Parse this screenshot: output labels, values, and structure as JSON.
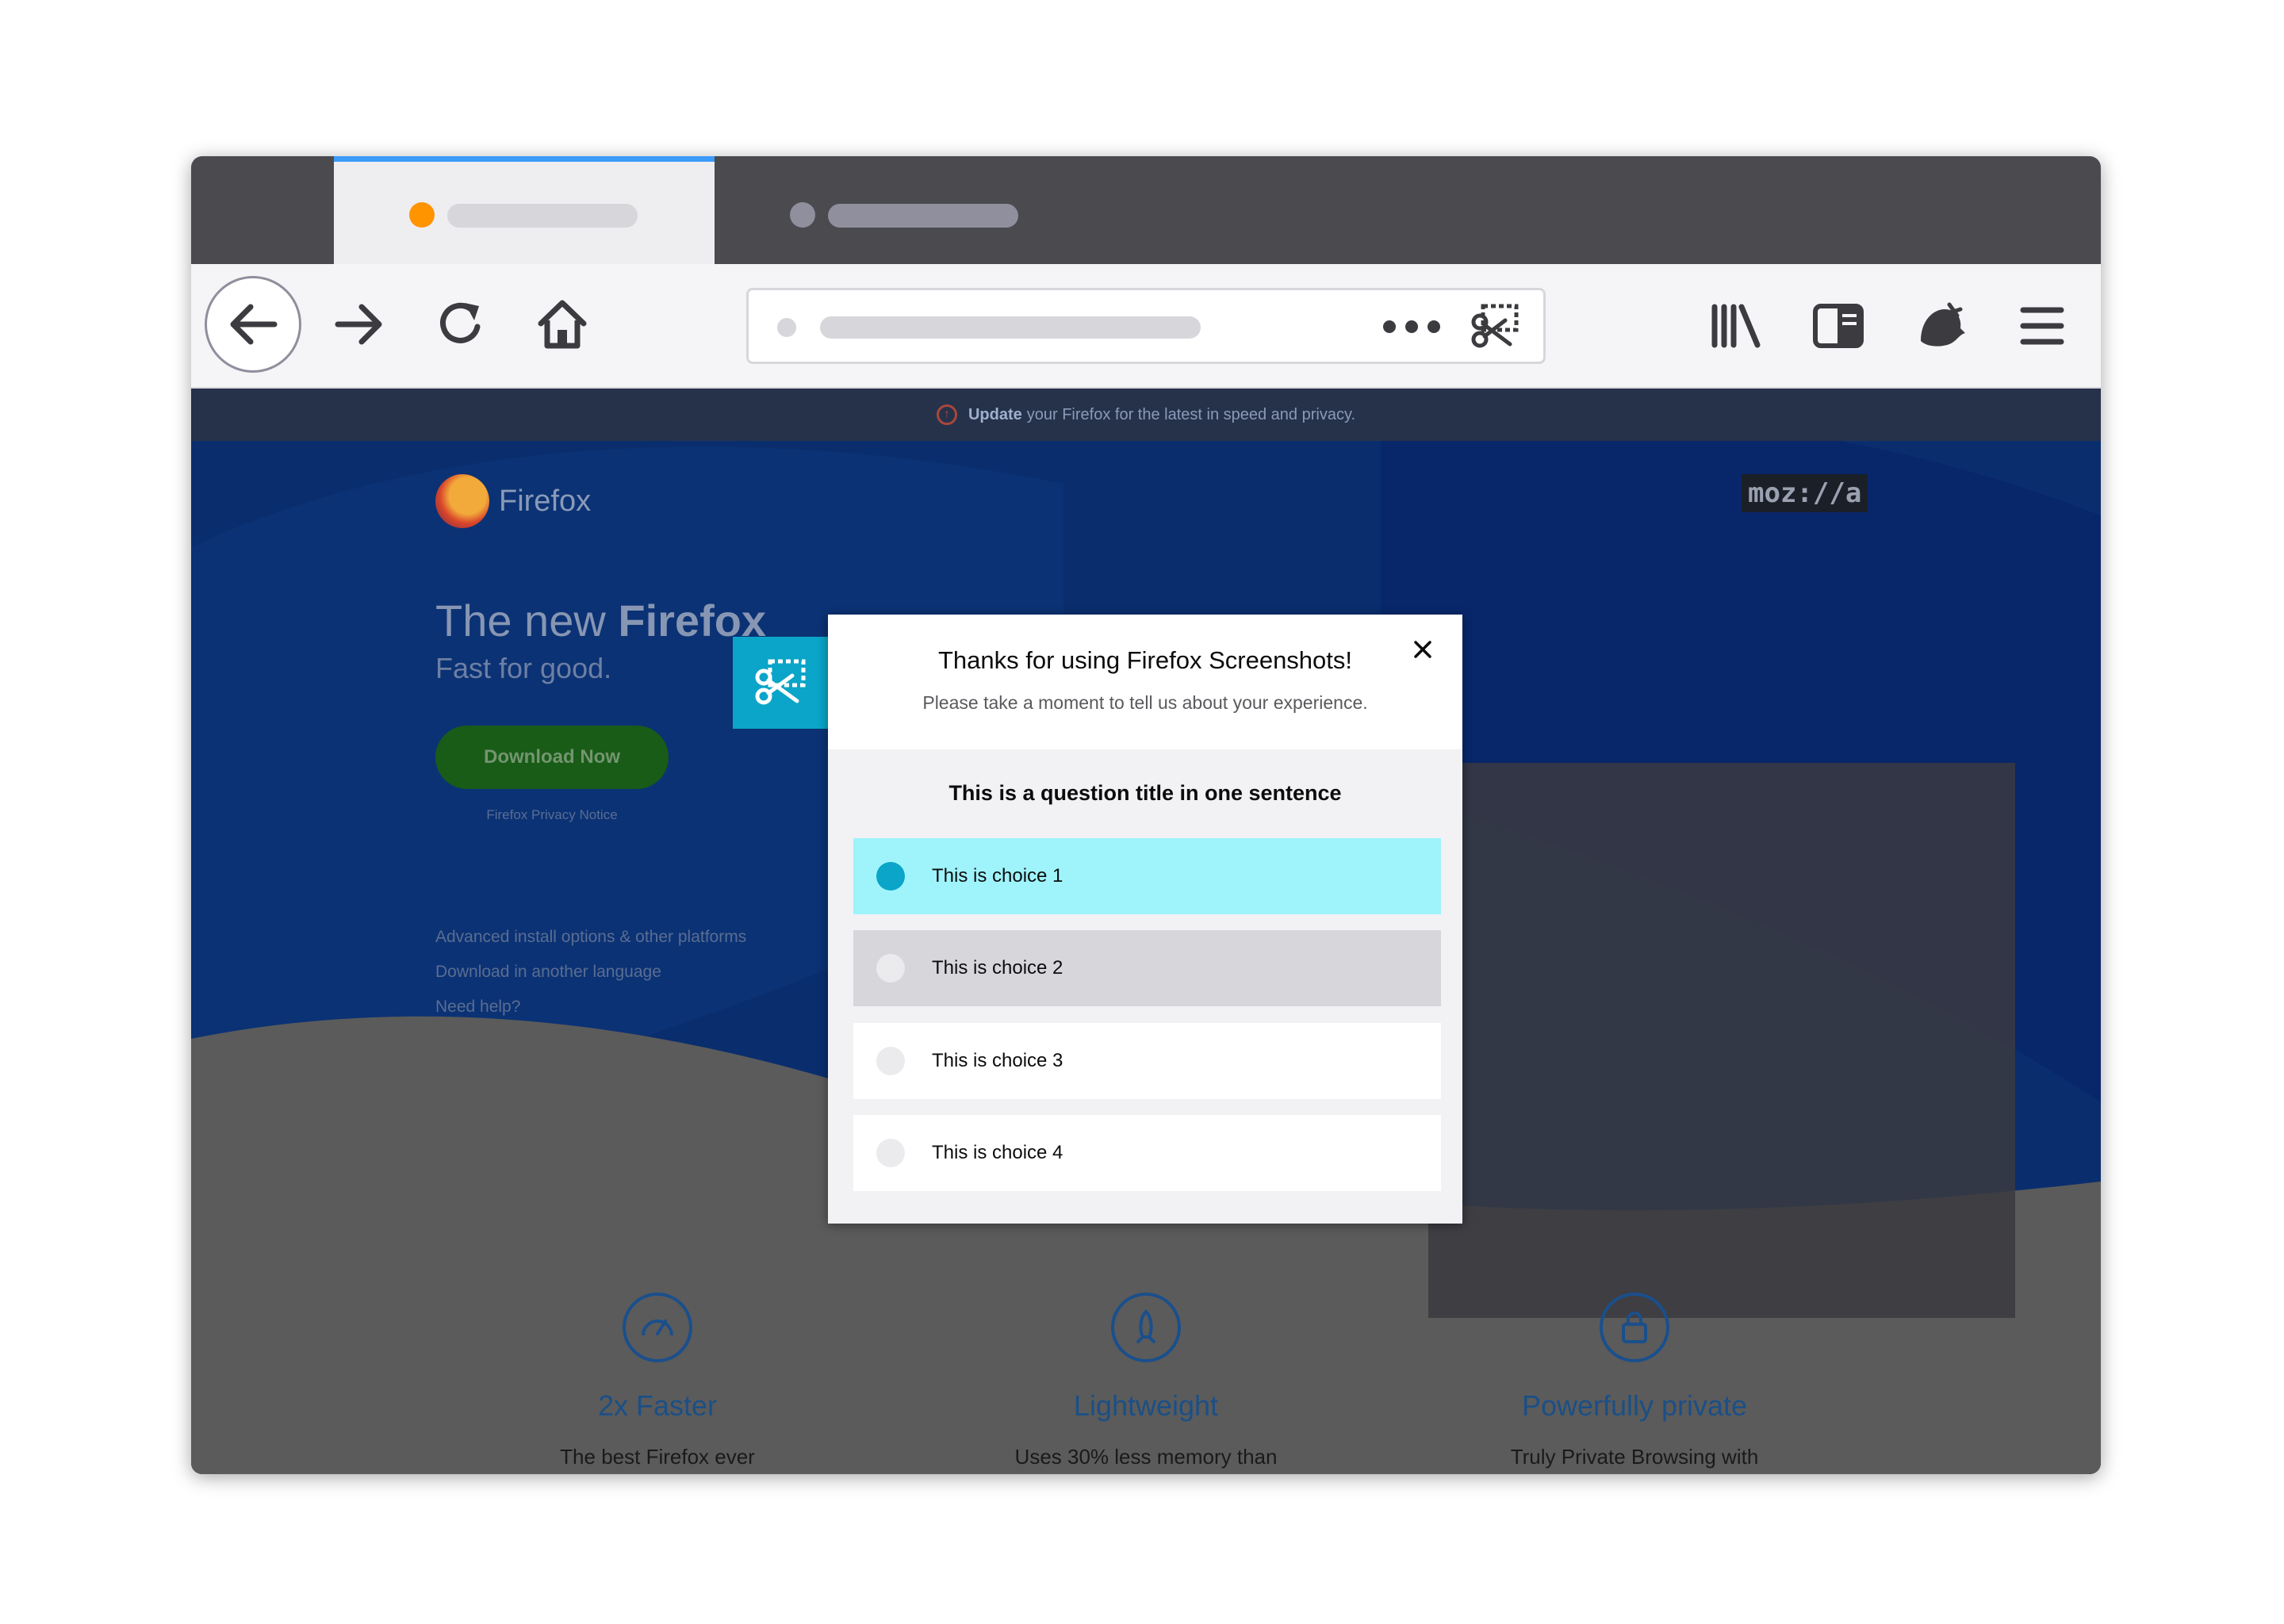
{
  "browser": {
    "toolbar": {
      "back_icon": "arrow-left-icon",
      "forward_icon": "arrow-right-icon",
      "reload_icon": "reload-icon",
      "home_icon": "home-icon",
      "page_actions_icon": "more-dots-icon",
      "screenshots_icon": "screenshots-icon",
      "library_icon": "library-icon",
      "sidebar_icon": "sidebar-icon",
      "account_icon": "firefox-account-icon",
      "menu_icon": "hamburger-menu-icon"
    },
    "colors": {
      "tab_accent": "#3c9af8",
      "tab_dot_active": "#ff9400",
      "screenshots_accent": "#0aa5c8",
      "selected_choice_bg": "#9ff4fb"
    }
  },
  "page": {
    "notice": {
      "bold": "Update",
      "text": "your Firefox for the latest in speed and privacy."
    },
    "brand": "Firefox",
    "mozilla": "moz://a",
    "hero": {
      "title_prefix": "The new",
      "title_bold": "Firefox",
      "subtitle": "Fast for good."
    },
    "download_button": "Download Now",
    "privacy_notice": "Firefox Privacy Notice",
    "links": [
      "Advanced install options & other platforms",
      "Download in another language",
      "Need help?"
    ],
    "features": [
      {
        "name": "2x Faster",
        "desc": "The best Firefox ever"
      },
      {
        "name": "Lightweight",
        "desc": "Uses 30% less memory than"
      },
      {
        "name": "Powerfully private",
        "desc": "Truly Private Browsing with"
      }
    ]
  },
  "survey": {
    "title": "Thanks for using Firefox Screenshots!",
    "subtitle": "Please take a moment to tell us about your experience.",
    "question": "This is a question title in one sentence",
    "choices": [
      {
        "label": "This is choice 1",
        "selected": true
      },
      {
        "label": "This is choice 2",
        "selected": false
      },
      {
        "label": "This is choice 3",
        "selected": false
      },
      {
        "label": "This is choice 4",
        "selected": false
      }
    ]
  }
}
